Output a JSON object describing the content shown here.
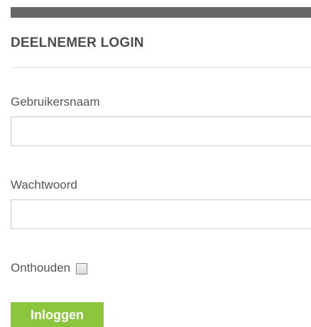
{
  "login": {
    "title": "DEELNEMER LOGIN",
    "username_label": "Gebruikersnaam",
    "username_value": "",
    "password_label": "Wachtwoord",
    "password_value": "",
    "remember_label": "Onthouden",
    "remember_checked": false,
    "submit_label": "Inloggen"
  },
  "colors": {
    "top_bar": "#666666",
    "button": "#8cc63f",
    "text": "#555555"
  }
}
